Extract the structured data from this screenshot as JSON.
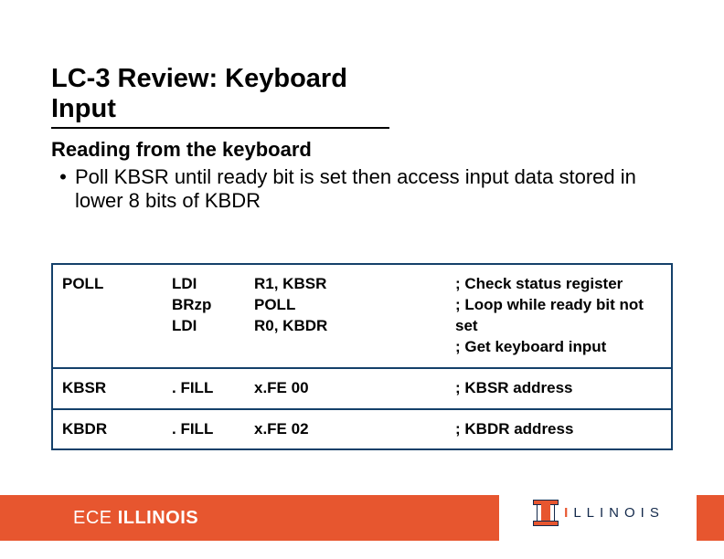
{
  "title": "LC-3 Review: Keyboard Input",
  "body": {
    "heading": "Reading from the keyboard",
    "bullet_marker": "•",
    "bullet_text": "Poll KBSR until ready bit is set then access input data stored in lower 8 bits of KBDR"
  },
  "code": {
    "rows": [
      {
        "label": "POLL",
        "opcode": "LDI\nBRzp\nLDI",
        "operand": "R1, KBSR\nPOLL\nR0, KBDR",
        "comment": "; Check status register\n; Loop while ready bit not set\n; Get keyboard input"
      },
      {
        "label": "KBSR",
        "opcode": ". FILL",
        "operand": "x.FE 00",
        "comment": "; KBSR address"
      },
      {
        "label": "KBDR",
        "opcode": ". FILL",
        "operand": "x.FE 02",
        "comment": "; KBDR address"
      }
    ]
  },
  "footer": {
    "ece_thin": "ECE ",
    "ece_bold": "ILLINOIS",
    "logo_text_pre": "I",
    "logo_text_rest": "LLINOIS"
  }
}
